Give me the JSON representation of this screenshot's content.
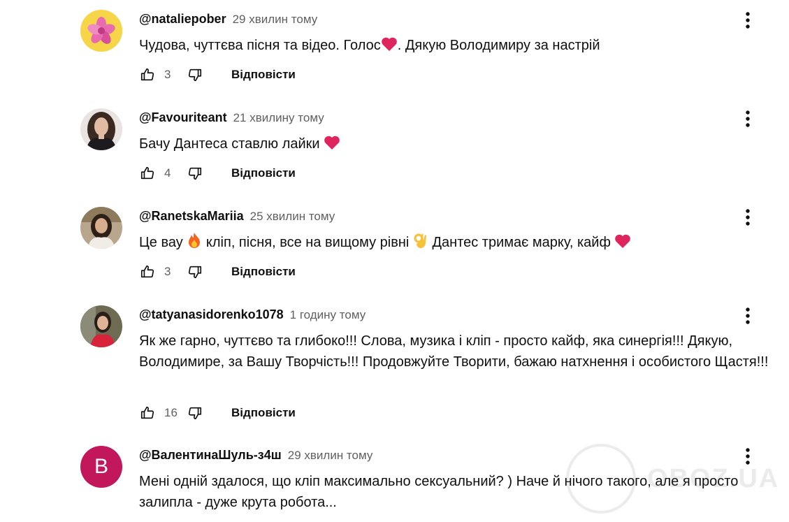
{
  "comments": [
    {
      "author": "@nataliepober",
      "time": "29 хвилин тому",
      "text_parts": [
        "Чудова, чуттєва пісня та відео. Голос",
        ". Дякую Володимиру за настрій"
      ],
      "likes": "3",
      "reply_label": "Відповісти"
    },
    {
      "author": "@Favouriteant",
      "time": "21 хвилину тому",
      "text_parts": [
        "Бачу Дантеса ставлю лайки "
      ],
      "likes": "4",
      "reply_label": "Відповісти"
    },
    {
      "author": "@RanetskaMariia",
      "time": "25 хвилин тому",
      "text_parts": [
        "Це вау ",
        " кліп, пісня, все на вищому рівні ",
        " Дантес тримає марку, кайф "
      ],
      "likes": "3",
      "reply_label": "Відповісти"
    },
    {
      "author": "@tatyanasidorenko1078",
      "time": "1 годину тому",
      "text_parts": [
        "Як же гарно, чуттєво та глибоко!!! Слова, музика і кліп - просто кайф, яка синергія!!! Дякую, Володимире, за Вашу Творчість!!! Продовжуйте Творити, бажаю натхнення і особистого Щастя!!!"
      ],
      "likes": "16",
      "reply_label": "Відповісти"
    },
    {
      "author": "@ВалентинаШуль-з4ш",
      "time": "29 хвилин тому",
      "text_parts": [
        "Мені одній здалося, що кліп максимально сексуальний? ) Наче й нічого такого, але я просто залипла - дуже крута робота..."
      ],
      "avatar_letter": "B",
      "avatar_color": "#c2185b"
    }
  ],
  "icons": {
    "like": "thumb-up-icon",
    "dislike": "thumb-down-icon",
    "menu": "more-vertical-icon",
    "heart": "red-heart-emoji",
    "fire": "fire-emoji",
    "ok_hand": "ok-hand-emoji"
  },
  "colors": {
    "heart": "#e0245e",
    "text": "#0f0f0f",
    "secondary": "#606060"
  },
  "watermark": {
    "text": "OBOZ.UA"
  }
}
